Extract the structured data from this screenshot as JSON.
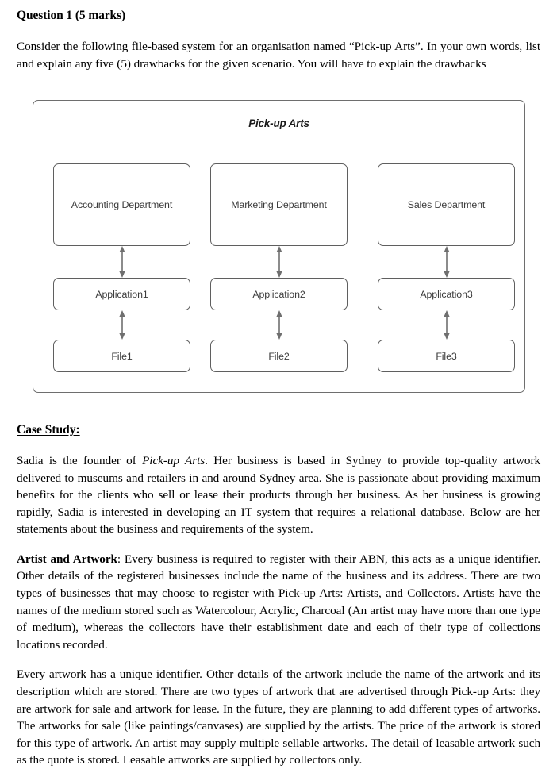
{
  "document": {
    "question_heading": "Question 1 (5 marks)",
    "intro_paragraph": {
      "part1": "Consider the following file-based system for an organisation named “Pick-up Arts”. In your own words, list and explain any five (5) drawbacks for the given scenario. You will have to explain the drawbacks"
    },
    "case_study_heading": "Case Study:",
    "case_study_paragraph": {
      "pre": "Sadia is the founder of ",
      "italic": "Pick-up Arts",
      "post": ". Her business is based in Sydney to provide top-quality artwork delivered to museums and retailers in and around Sydney area. She is passionate about providing maximum benefits for the clients who sell or lease their products through her business. As her business is growing rapidly, Sadia is interested in developing an IT system that requires a relational database. Below are her statements about the business and requirements of the system."
    },
    "artist_paragraph": {
      "bold": "Artist and Artwork",
      "rest": ": Every business is required to register with their ABN, this acts as a unique identifier. Other details of the registered businesses include the name of the business and its address. There are two types of businesses that may choose to register with Pick-up Arts: Artists, and Collectors. Artists have the names of the medium stored such as Watercolour, Acrylic, Charcoal (An artist may have more than one type of medium), whereas the collectors have their establishment date and each of their type of collections locations recorded."
    },
    "artwork_paragraph": {
      "text": "Every artwork has a unique identifier. Other details of the artwork include the name of the artwork and its description which are stored. There are two types of artwork that are advertised through Pick-up Arts: they are artwork for sale and artwork for lease. In the future, they are planning to add different types of artworks. The artworks for sale (like paintings/canvases) are supplied by the artists. The price of the artwork is stored for this type of artwork. An artist may supply multiple sellable artworks. The detail of leasable artwork such as the quote is stored. Leasable artworks are supplied by collectors only."
    }
  },
  "diagram": {
    "title": "Pick-up Arts",
    "columns": [
      {
        "department": "Accounting Department",
        "application": "Application1",
        "file": "File1"
      },
      {
        "department": "Marketing Department",
        "application": "Application2",
        "file": "File2"
      },
      {
        "department": "Sales Department",
        "application": "Application3",
        "file": "File3"
      }
    ],
    "arrow_icon": "double-headed-vertical-arrow-icon",
    "colors": {
      "box_border": "#5f6161",
      "outer_border": "#6e6e6e",
      "box_text": "#3b3b3b",
      "arrow": "#6f6f6f",
      "body_text": "#000000",
      "page_background": "#ffffff"
    }
  }
}
